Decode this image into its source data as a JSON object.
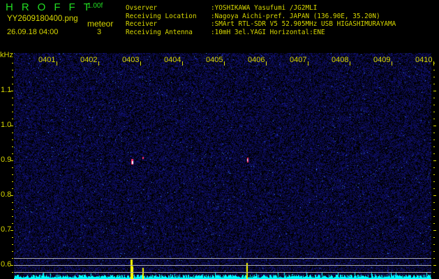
{
  "header": {
    "brand": "HROFFT",
    "version": "1.00f",
    "filename": "YY2609180400.png",
    "datetime": "26.09.18 04:00",
    "meteor_label": "meteor",
    "meteor_count": "3"
  },
  "info": [
    {
      "label": "Ovserver",
      "value": ":YOSHIKAWA Yasufumi /JG2MLI"
    },
    {
      "label": "Receiving Location",
      "value": ":Nagoya Aichi-pref. JAPAN (136.90E, 35.20N)"
    },
    {
      "label": "Receiver",
      "value": ":SMArt RTL-SDR V5 52.905MHz USB HIGASHIMURAYAMA"
    },
    {
      "label": "Receiving Antenna",
      "value": ":10mH 3el.YAGI Horizontal:ENE"
    }
  ],
  "axis": {
    "unit": "kHz",
    "time_labels": [
      "0401",
      "0402",
      "0403",
      "0404",
      "0405",
      "0406",
      "0407",
      "0408",
      "0409",
      "0410"
    ],
    "freq_labels": [
      "1.1",
      "1.0",
      "0.9",
      "0.8",
      "0.7",
      "0.6"
    ]
  },
  "colors": {
    "text": "#d8d800",
    "brand": "#22dd22",
    "noise": "#1a1a8a",
    "histogram": "#00ffff",
    "spike": "#ffff00"
  }
}
